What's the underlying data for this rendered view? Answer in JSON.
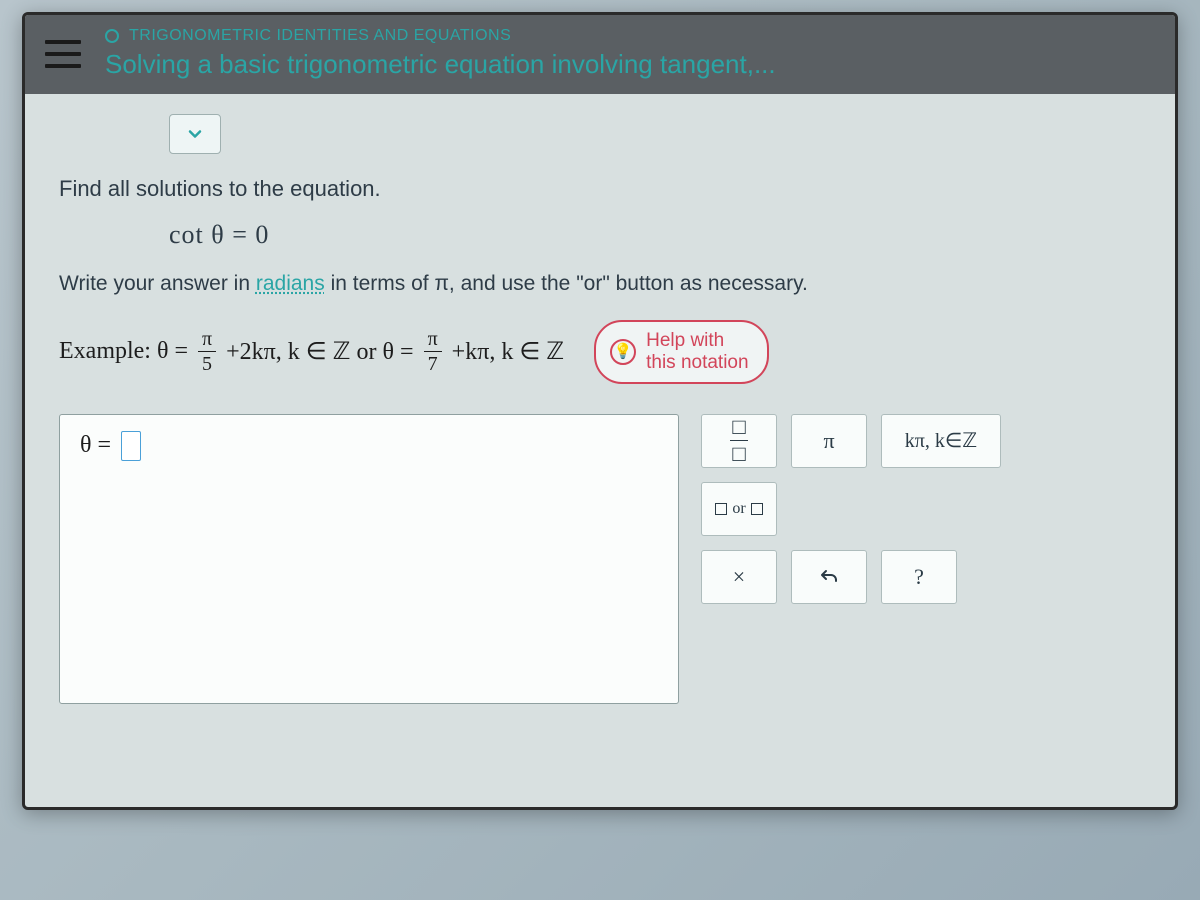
{
  "header": {
    "category": "TRIGONOMETRIC IDENTITIES AND EQUATIONS",
    "topic": "Solving a basic trigonometric equation involving tangent,..."
  },
  "problem": {
    "prompt": "Find all solutions to the equation.",
    "equation": "cot θ = 0",
    "instruction_pre": "Write your answer in ",
    "radians_word": "radians",
    "instruction_mid": " in terms of π, and use the ",
    "or_quoted": "\"or\"",
    "instruction_post": " button as necessary."
  },
  "example": {
    "label": "Example: θ =",
    "frac1_num": "π",
    "frac1_den": "5",
    "part1_tail": "+2kπ, k ∈ ℤ or θ =",
    "frac2_num": "π",
    "frac2_den": "7",
    "part2_tail": "+kπ, k ∈ ℤ"
  },
  "help": {
    "line1": "Help with",
    "line2": "this notation"
  },
  "answer": {
    "theta_equals": "θ ="
  },
  "palette": {
    "frac_top": "□",
    "frac_bot": "□",
    "pi": "π",
    "kpi": "kπ, k∈ℤ",
    "or_label": "or",
    "clear": "×",
    "help_q": "?"
  }
}
